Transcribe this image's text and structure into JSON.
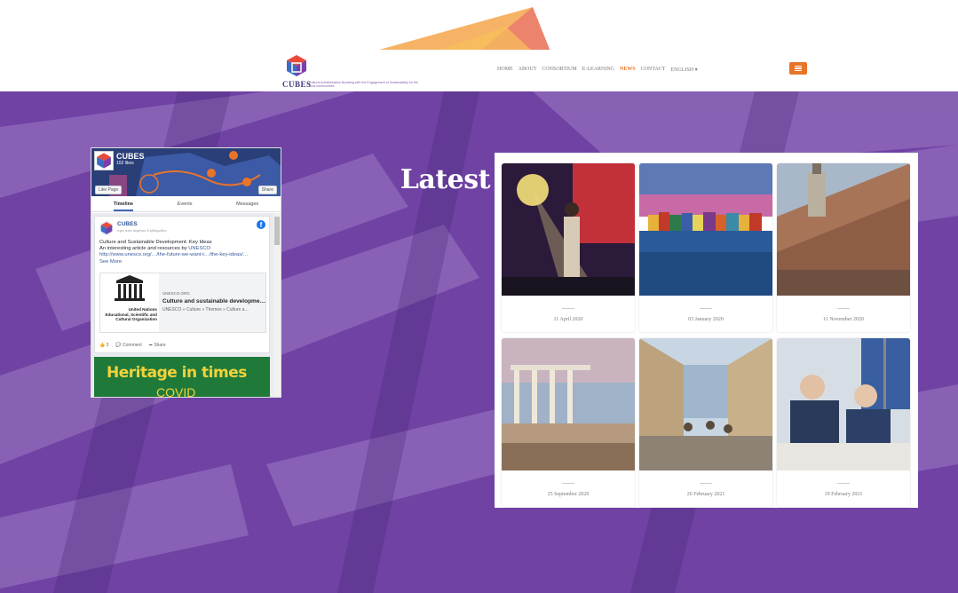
{
  "brand": {
    "name": "CUBES",
    "tagline": "Cultural Administration Boosting with the Engagement of Sustainability for the local communities",
    "accent_color": "#e8742a",
    "purple_color": "#6b3fa0"
  },
  "nav": {
    "items": [
      {
        "label": "HOME"
      },
      {
        "label": "ABOUT"
      },
      {
        "label": "CONSORTIUM"
      },
      {
        "label": "E-LEARNING"
      },
      {
        "label": "NEWS"
      },
      {
        "label": "CONTACT"
      },
      {
        "label": "ENGLISH ▾"
      }
    ],
    "active": "NEWS",
    "menu_icon": "hamburger-icon"
  },
  "hero": {
    "title": "Latest News"
  },
  "facebook": {
    "page_name": "CUBES",
    "likes": "102 likes",
    "like_button": "Like Page",
    "share_button": "Share",
    "tabs": [
      "Timeline",
      "Events",
      "Messages"
    ],
    "post": {
      "author": "CUBES",
      "time": "πριν από περίπου 8 εβδομάδες",
      "line1": "Culture and Sustainable Development: Key Ideas",
      "line2_prefix": "An interesting article and resources by ",
      "line2_link": "UNESCO",
      "url": "http://www.unesco.org/…/the-future-we-want-t…/the-key-ideas/…",
      "see_more": "See More",
      "card_domain": "UNESCO.ORG",
      "card_title": "Culture and sustainable development...",
      "card_desc": "UNESCO » Culture » Themes » Culture a...",
      "logo_text_1": "United Nations",
      "logo_text_2": "Educational, Scientific and",
      "logo_text_3": "Cultural Organization",
      "action_likes": "3",
      "action_comment": "Comment",
      "action_share": "Share"
    },
    "next_post_text": "Heritage in times",
    "next_post_sub": "COVID"
  },
  "news": [
    {
      "date": "11 April 2020",
      "image": "concert-stage"
    },
    {
      "date": "03 January 2020",
      "image": "colorful-harbour"
    },
    {
      "date": "11 November 2020",
      "image": "roof-restoration"
    },
    {
      "date": "25 September 2020",
      "image": "ancient-theatre"
    },
    {
      "date": "26 February 2021",
      "image": "village-street"
    },
    {
      "date": "19 February 2021",
      "image": "agreement-signing"
    }
  ]
}
